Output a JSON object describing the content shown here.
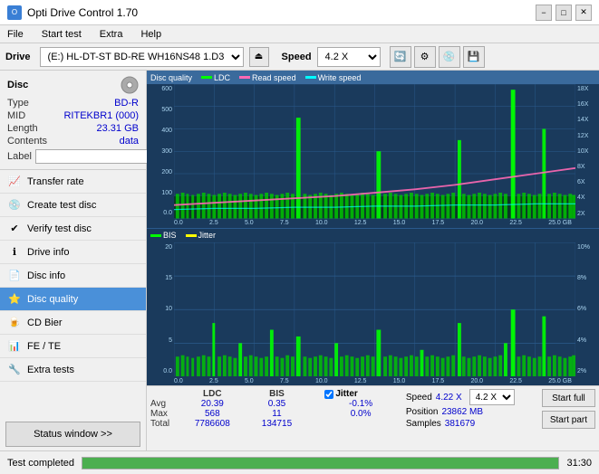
{
  "app": {
    "title": "Opti Drive Control 1.70",
    "icon": "ODC"
  },
  "titlebar": {
    "minimize": "−",
    "maximize": "□",
    "close": "✕"
  },
  "menu": {
    "items": [
      "File",
      "Start test",
      "Extra",
      "Help"
    ]
  },
  "toolbar": {
    "drive_label": "Drive",
    "drive_value": "(E:) HL-DT-ST BD-RE  WH16NS48 1.D3",
    "speed_label": "Speed",
    "speed_value": "4.2 X"
  },
  "disc": {
    "type_label": "Type",
    "type_value": "BD-R",
    "mid_label": "MID",
    "mid_value": "RITEKBR1 (000)",
    "length_label": "Length",
    "length_value": "23.31 GB",
    "contents_label": "Contents",
    "contents_value": "data",
    "label_label": "Label",
    "label_value": ""
  },
  "nav": {
    "items": [
      {
        "id": "transfer-rate",
        "label": "Transfer rate",
        "icon": "📈"
      },
      {
        "id": "create-test-disc",
        "label": "Create test disc",
        "icon": "💿"
      },
      {
        "id": "verify-test-disc",
        "label": "Verify test disc",
        "icon": "✔"
      },
      {
        "id": "drive-info",
        "label": "Drive info",
        "icon": "ℹ"
      },
      {
        "id": "disc-info",
        "label": "Disc info",
        "icon": "📄"
      },
      {
        "id": "disc-quality",
        "label": "Disc quality",
        "icon": "⭐",
        "active": true
      },
      {
        "id": "cd-bier",
        "label": "CD Bier",
        "icon": "🍺"
      },
      {
        "id": "fe-te",
        "label": "FE / TE",
        "icon": "📊"
      },
      {
        "id": "extra-tests",
        "label": "Extra tests",
        "icon": "🔧"
      }
    ]
  },
  "chart1": {
    "title": "Disc quality",
    "legend": [
      {
        "label": "LDC",
        "color": "#00ff00"
      },
      {
        "label": "Read speed",
        "color": "#ff69b4"
      },
      {
        "label": "Write speed",
        "color": "#00ffff"
      }
    ],
    "y_left": [
      "600",
      "500",
      "400",
      "300",
      "200",
      "100",
      "0.0"
    ],
    "y_right": [
      "18X",
      "16X",
      "14X",
      "12X",
      "10X",
      "8X",
      "6X",
      "4X",
      "2X"
    ],
    "x_axis": [
      "0.0",
      "2.5",
      "5.0",
      "7.5",
      "10.0",
      "12.5",
      "15.0",
      "17.5",
      "20.0",
      "22.5",
      "25.0 GB"
    ]
  },
  "chart2": {
    "legend": [
      {
        "label": "BIS",
        "color": "#00ff00"
      },
      {
        "label": "Jitter",
        "color": "#ffff00"
      }
    ],
    "y_left": [
      "20",
      "15",
      "10",
      "5",
      "0.0"
    ],
    "y_right": [
      "10%",
      "8%",
      "6%",
      "4%",
      "2%"
    ],
    "x_axis": [
      "0.0",
      "2.5",
      "5.0",
      "7.5",
      "10.0",
      "12.5",
      "15.0",
      "17.5",
      "20.0",
      "22.5",
      "25.0 GB"
    ]
  },
  "stats": {
    "headers": [
      "LDC",
      "BIS",
      "",
      "Jitter",
      "Speed",
      ""
    ],
    "avg_label": "Avg",
    "avg_ldc": "20.39",
    "avg_bis": "0.35",
    "avg_jitter": "-0.1%",
    "max_label": "Max",
    "max_ldc": "568",
    "max_bis": "11",
    "max_jitter": "0.0%",
    "total_label": "Total",
    "total_ldc": "7786608",
    "total_bis": "134715",
    "jitter_check": "Jitter",
    "speed_label": "Speed",
    "speed_value": "4.22 X",
    "speed_select": "4.2 X",
    "position_label": "Position",
    "position_value": "23862 MB",
    "samples_label": "Samples",
    "samples_value": "381679",
    "start_full": "Start full",
    "start_part": "Start part"
  },
  "statusbar": {
    "text": "Test completed",
    "progress": 100,
    "time": "31:30"
  }
}
